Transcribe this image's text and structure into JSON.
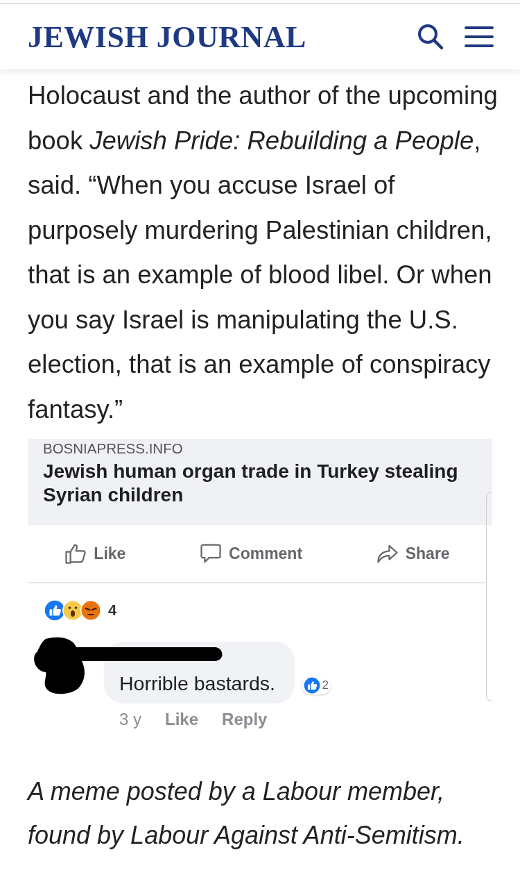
{
  "header": {
    "logo": "JEWISH JOURNAL"
  },
  "article": {
    "paragraph": "Holocaust and the author of the upcoming book *Jewish Pride: Rebuilding a People*, said. “When you accuse Israel of purposely murdering Palestinian children, that is an example of blood libel. Or when you say Israel is manipulating the U.S. election, that is an example of conspiracy fantasy.”"
  },
  "embed": {
    "link_preview": {
      "domain": "BOSNIAPRESS.INFO",
      "title": "Jewish human organ trade in Turkey stealing Syrian children"
    },
    "actions": [
      {
        "kind": "like",
        "label": "Like"
      },
      {
        "kind": "comment",
        "label": "Comment"
      },
      {
        "kind": "share",
        "label": "Share"
      }
    ],
    "reactions": {
      "count": "4"
    },
    "comment": {
      "text": "Horrible bastards.",
      "likes": "2",
      "time": "3 y",
      "actions": [
        "Like",
        "Reply"
      ]
    }
  },
  "caption": "A meme posted by a Labour member, found by Labour Against Anti-Semitism."
}
